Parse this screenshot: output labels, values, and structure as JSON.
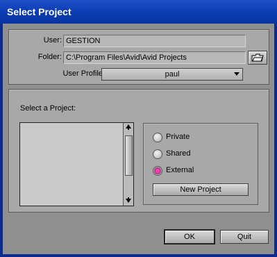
{
  "window": {
    "title": "Select Project"
  },
  "user": {
    "label": "User:",
    "value": "GESTION"
  },
  "folder": {
    "label": "Folder:",
    "value": "C:\\Program Files\\Avid\\Avid Projects"
  },
  "profile": {
    "label": "User Profile:",
    "selected": "paul"
  },
  "projects": {
    "label": "Select a Project:",
    "items": []
  },
  "project_type": {
    "options": [
      {
        "label": "Private",
        "selected": false
      },
      {
        "label": "Shared",
        "selected": false
      },
      {
        "label": "External",
        "selected": true
      }
    ]
  },
  "buttons": {
    "new_project": "New Project",
    "ok": "OK",
    "quit": "Quit"
  },
  "icons": {
    "folder_browse": "folder-browse-icon",
    "scroll_up": "arrow-up-icon",
    "scroll_down": "arrow-down-icon"
  },
  "colors": {
    "titlebar": "#0b3bb0",
    "dialog_bg": "#a8a8a8",
    "radio_selected": "#ff3fb0"
  }
}
